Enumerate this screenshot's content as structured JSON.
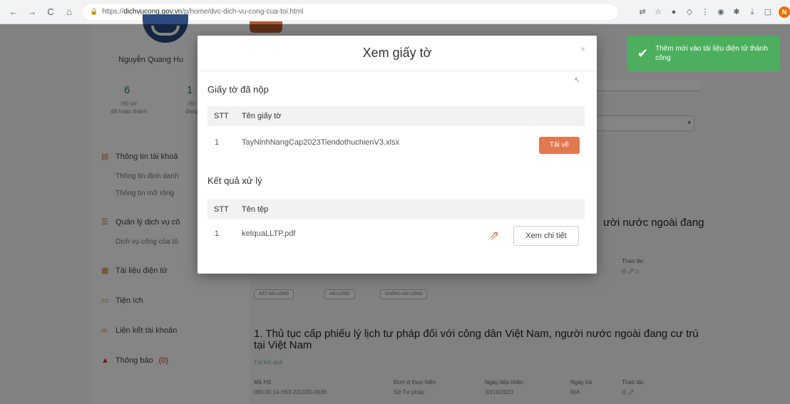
{
  "browser": {
    "nav": {
      "back": "←",
      "forward": "→",
      "reload": "C",
      "home": "⌂"
    },
    "url_prefix": "https://",
    "url_domain": "dichvucong.gov.vn",
    "url_path": "/p/home/dvc-dich-vu-cong-cua-toi.html",
    "profile_letter": "N"
  },
  "sidebar": {
    "user_name": "Nguyễn Quang Hu",
    "stats": [
      {
        "num": "6",
        "label_line1": "Hồ sơ",
        "label_line2": "đã hoàn thành"
      },
      {
        "num": "1",
        "label_line1": "Hồ",
        "label_line2": "đang"
      }
    ],
    "items": [
      {
        "label": "Thông tin tài khoả",
        "icon": "user-card-icon"
      },
      {
        "label": "Quản lý dịch vụ cô",
        "icon": "list-icon"
      },
      {
        "label": "Tài liệu điện tử",
        "icon": "document-icon"
      },
      {
        "label": "Tiện ích",
        "icon": "folder-icon"
      },
      {
        "label": "Liên kết tài khoản",
        "icon": "link-icon"
      },
      {
        "label": "Thông báo",
        "count": "(0)",
        "icon": "bell-icon"
      }
    ],
    "subitems": [
      "Thông tin định danh",
      "Thông tin mở rộng",
      "Dịch vụ công của tô"
    ]
  },
  "main": {
    "heading_right": "ười nước ngoài đang",
    "record_title": "1. Thủ tục cấp phiếu lý lịch tư pháp đối với công dân Việt Nam, người nước ngoài đang cư trú tại Việt Nam",
    "record_link": "Trả kết quả",
    "columns": [
      "Mã HS",
      "Đơn vị thực hiện",
      "Ngày tiếp nhận",
      "Ngày trả",
      "Thao tác"
    ],
    "values": [
      "000.00.14.H53-231030-0036",
      "Sở Tư pháp",
      "30/10/2023",
      "N/A"
    ],
    "filter_chips": [
      "RẤT HÀI LÒNG",
      "HÀI LÒNG",
      "KHÔNG HÀI LÒNG"
    ],
    "action_label_top": "Thao tác"
  },
  "toast": {
    "message": "Thêm mới vào tài liệu điện tử thành công"
  },
  "modal": {
    "title": "Xem giấy tờ",
    "close_glyph": "×",
    "submitted": {
      "title": "Giấy tờ đã nộp",
      "headers": {
        "stt": "STT",
        "name": "Tên giấy tờ"
      },
      "rows": [
        {
          "stt": "1",
          "name": "TayNinhNangCap2023TiendothuchienV3.xlsx"
        }
      ],
      "download_label": "Tải về"
    },
    "results": {
      "title": "Kết quả xử lý",
      "headers": {
        "stt": "STT",
        "name": "Tên tệp"
      },
      "rows": [
        {
          "stt": "1",
          "name": "ketquaLLTP.pdf"
        }
      ],
      "detail_label": "Xem chi tiết"
    }
  }
}
